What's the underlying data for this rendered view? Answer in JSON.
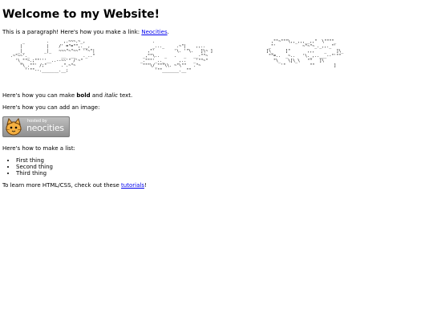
{
  "heading": "Welcome to my Website!",
  "intro": {
    "text": "This is a paragraph! Here's how you make a link: ",
    "link": "Neocities",
    "after": "."
  },
  "ascii_art": [
    "      _         .      ,.~~~.~_,\n     |          |    /' =\"=\"\",.__,\n    _|_        _|_   ~~~\"~\"~~\" '\"~\"|\n .~\"~~'._             __  __   ._..\"\n   '\\_\"\"~.;\"\"'''__..--~~'\" /'~\"\n     \"\\_.\"\"' /;\"      .\".~\"~\n       ''\"\"--._______.__;",
    "       .\n       _..._     .~\"|    ,,..\n     ,\"'        '\\. '\"\\.   ]\\~ ]\n   _,\"\"\\..  _   .   _   __-\"\"~\n  _.\"\"\"'_.._      ,..   _'\"\"~\"\n   \"\"\"\\/_\"\"\"\\\\. ~\"\\\"\"   .\"~\n        '\"\"_______.__\"\"",
    "    ,\"\"~\"\"\"\\,,_,,,__,,\"  \\\"\"\"\"_\n   _\"'           ~\"~\"~_._,,._\"'\n  ]\\_     ]\"       ,,,    _    ]\\_\n   \"\"=..  _~..   '\\._,..___--\"'\"\"\n     \"\\_   \\]\\_\\   \"\"   ]\\\n        '\"          \"\"        ]"
  ],
  "bold_line": {
    "before": "Here's how you can make ",
    "bold": "bold",
    "middle": " and ",
    "italic": "italic",
    "after": " text."
  },
  "image_line": "Here's how you can add an image:",
  "badge": {
    "hosted": "hosted by",
    "name": "neocities"
  },
  "list_line": "Here's how to make a list:",
  "list_items": [
    "First thing",
    "Second thing",
    "Third thing"
  ],
  "tutorial_line": {
    "before": "To learn more HTML/CSS, check out these ",
    "link": "tutorials",
    "after": "!"
  },
  "colors": {
    "link": "#0000ee",
    "badge_bg": "#a8a8a8",
    "text": "#000000"
  }
}
